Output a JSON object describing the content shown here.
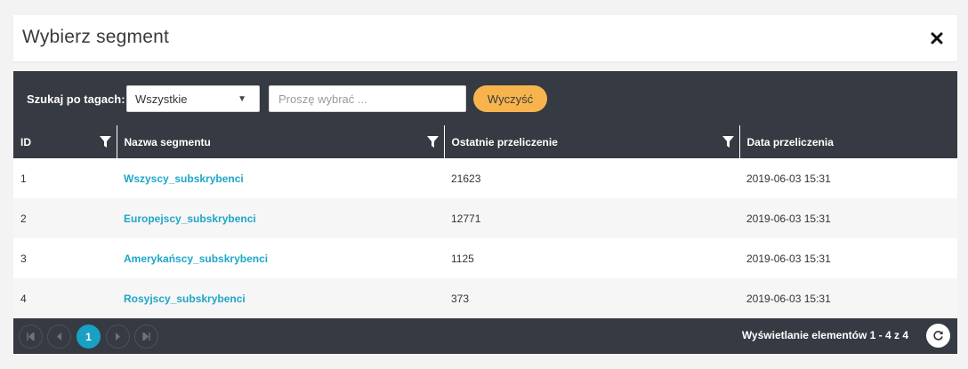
{
  "header": {
    "title": "Wybierz segment"
  },
  "toolbar": {
    "tag_label": "Szukaj po tagach:",
    "tag_select_value": "Wszystkie",
    "tag_input_placeholder": "Proszę wybrać ...",
    "tag_input_value": "",
    "clear_label": "Wyczyść"
  },
  "table": {
    "columns": [
      "ID",
      "Nazwa segmentu",
      "Ostatnie przeliczenie",
      "Data przeliczenia"
    ],
    "rows": [
      {
        "id": "1",
        "name": "Wszyscy_subskrybenci",
        "count": "21623",
        "date": "2019-06-03 15:31"
      },
      {
        "id": "2",
        "name": "Europejscy_subskrybenci",
        "count": "12771",
        "date": "2019-06-03 15:31"
      },
      {
        "id": "3",
        "name": "Amerykańscy_subskrybenci",
        "count": "1125",
        "date": "2019-06-03 15:31"
      },
      {
        "id": "4",
        "name": "Rosyjscy_subskrybenci",
        "count": "373",
        "date": "2019-06-03 15:31"
      }
    ]
  },
  "pager": {
    "current_page": "1",
    "info": "Wyświetlanie elementów 1 - 4 z 4"
  },
  "colors": {
    "panel": "#363a42",
    "accent": "#1aa0c4",
    "link": "#1fa6c8",
    "clear_button": "#f7b44e"
  }
}
